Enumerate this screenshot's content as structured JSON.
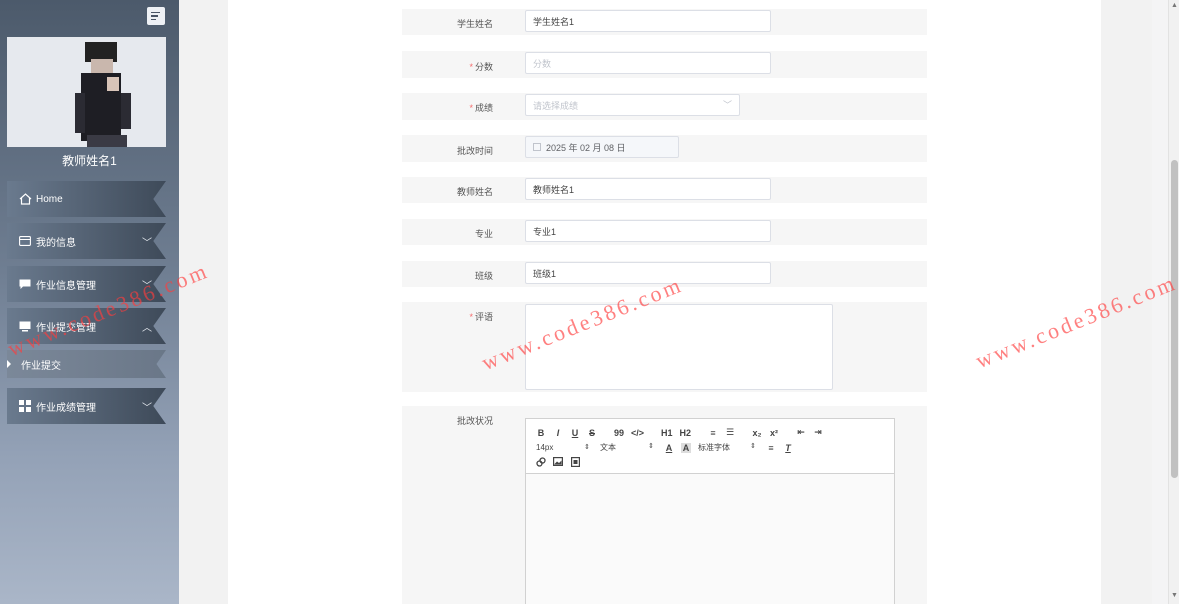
{
  "sidebar": {
    "user_name": "教师姓名1",
    "menu": [
      {
        "label": "Home",
        "icon": "home-icon"
      },
      {
        "label": "我的信息",
        "icon": "card-icon"
      },
      {
        "label": "作业信息管理",
        "icon": "chat-icon"
      },
      {
        "label": "作业提交管理",
        "icon": "monitor-icon"
      },
      {
        "label": "作业成绩管理",
        "icon": "grid-icon"
      }
    ],
    "submenu": [
      {
        "label": "作业提交"
      }
    ]
  },
  "form": {
    "student_name": {
      "label": "学生姓名",
      "value": "学生姓名1"
    },
    "score": {
      "label": "分数",
      "placeholder": "分数",
      "required": true
    },
    "grade": {
      "label": "成绩",
      "placeholder": "请选择成绩",
      "required": true
    },
    "review_time": {
      "label": "批改时间",
      "value": "2025 年 02 月 08 日"
    },
    "teacher_name": {
      "label": "教师姓名",
      "value": "教师姓名1"
    },
    "major": {
      "label": "专业",
      "value": "专业1"
    },
    "class": {
      "label": "班级",
      "value": "班级1"
    },
    "comment": {
      "label": "评语",
      "required": true
    },
    "review_status": {
      "label": "批改状况"
    }
  },
  "editor": {
    "buttons_row1": [
      "B",
      "I",
      "U",
      "S",
      "99",
      "</>",
      "H1",
      "H2",
      "≡",
      "☰",
      "x₂",
      "x²",
      "⇤",
      "⇥"
    ],
    "font_size": "14px",
    "text_type": "文本",
    "font_family": "标准字体",
    "buttons_row3": [
      "🔗",
      "▣",
      "▤"
    ]
  },
  "watermark": "www.code386.com",
  "colors": {
    "required": "#f56c6c",
    "watermark": "#ff3c3c"
  }
}
